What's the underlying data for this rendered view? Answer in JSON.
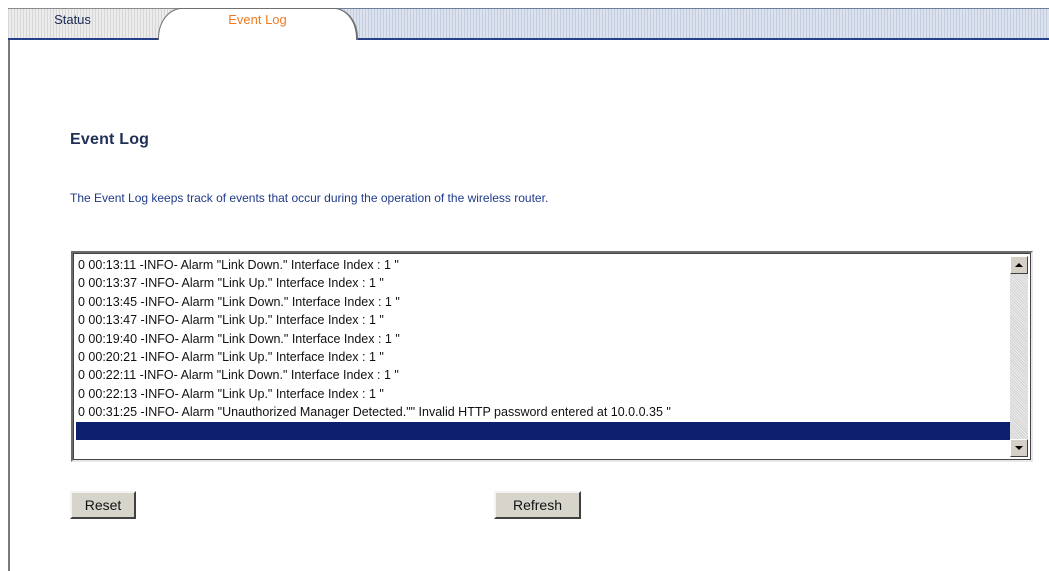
{
  "tabs": [
    {
      "label": "Status",
      "active": false
    },
    {
      "label": "Event Log",
      "active": true
    }
  ],
  "page": {
    "title": "Event Log",
    "description": "The Event Log keeps track of events that occur during the operation of the wireless router."
  },
  "log": {
    "entries": [
      "0 00:13:11 -INFO- Alarm \"Link Down.\" Interface Index : 1 \"",
      "0 00:13:37 -INFO- Alarm \"Link Up.\" Interface Index : 1 \"",
      "0 00:13:45 -INFO- Alarm \"Link Down.\" Interface Index : 1 \"",
      "0 00:13:47 -INFO- Alarm \"Link Up.\" Interface Index : 1 \"",
      "0 00:19:40 -INFO- Alarm \"Link Down.\" Interface Index : 1 \"",
      "0 00:20:21 -INFO- Alarm \"Link Up.\" Interface Index : 1 \"",
      "0 00:22:11 -INFO- Alarm \"Link Down.\" Interface Index : 1 \"",
      "0 00:22:13 -INFO- Alarm \"Link Up.\" Interface Index : 1 \"",
      "0 00:31:25 -INFO- Alarm \"Unauthorized Manager Detected.\"\" Invalid HTTP password entered at 10.0.0.35 \"",
      ""
    ],
    "selected_index": 9
  },
  "buttons": {
    "reset": "Reset",
    "refresh": "Refresh"
  },
  "colors": {
    "active_tab_text": "#ee7b22",
    "title_text": "#1f2f55",
    "description_text": "#1f3a8a",
    "selection": "#0d1f6e"
  },
  "icons": {
    "scroll_up": "triangle-up",
    "scroll_down": "triangle-down"
  }
}
